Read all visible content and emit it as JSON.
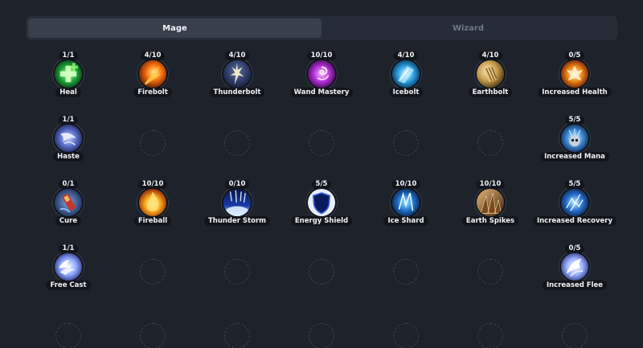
{
  "tabs": [
    {
      "label": "Mage",
      "active": true
    },
    {
      "label": "Wizard",
      "active": false
    }
  ],
  "skills": [
    {
      "name": "Heal",
      "level": "1/1",
      "icon": "heal-icon"
    },
    {
      "name": "Firebolt",
      "level": "4/10",
      "icon": "firebolt-icon"
    },
    {
      "name": "Thunderbolt",
      "level": "4/10",
      "icon": "thunderbolt-icon"
    },
    {
      "name": "Wand Mastery",
      "level": "10/10",
      "icon": "wand-mastery-icon"
    },
    {
      "name": "Icebolt",
      "level": "4/10",
      "icon": "icebolt-icon"
    },
    {
      "name": "Earthbolt",
      "level": "4/10",
      "icon": "earthbolt-icon"
    },
    {
      "name": "Increased Health",
      "level": "0/5",
      "icon": "increased-health-icon"
    },
    {
      "name": "Haste",
      "level": "1/1",
      "icon": "haste-icon"
    },
    {
      "name": "Increased Mana",
      "level": "5/5",
      "icon": "increased-mana-icon"
    },
    {
      "name": "Cure",
      "level": "0/1",
      "icon": "cure-icon"
    },
    {
      "name": "Fireball",
      "level": "10/10",
      "icon": "fireball-icon"
    },
    {
      "name": "Thunder Storm",
      "level": "0/10",
      "icon": "thunder-storm-icon"
    },
    {
      "name": "Energy Shield",
      "level": "5/5",
      "icon": "energy-shield-icon"
    },
    {
      "name": "Ice Shard",
      "level": "10/10",
      "icon": "ice-shard-icon"
    },
    {
      "name": "Earth Spikes",
      "level": "10/10",
      "icon": "earth-spikes-icon"
    },
    {
      "name": "Increased Recovery",
      "level": "5/5",
      "icon": "increased-recovery-icon"
    },
    {
      "name": "Free Cast",
      "level": "1/1",
      "icon": "free-cast-icon"
    },
    {
      "name": "Increased Flee",
      "level": "0/5",
      "icon": "increased-flee-icon"
    }
  ]
}
